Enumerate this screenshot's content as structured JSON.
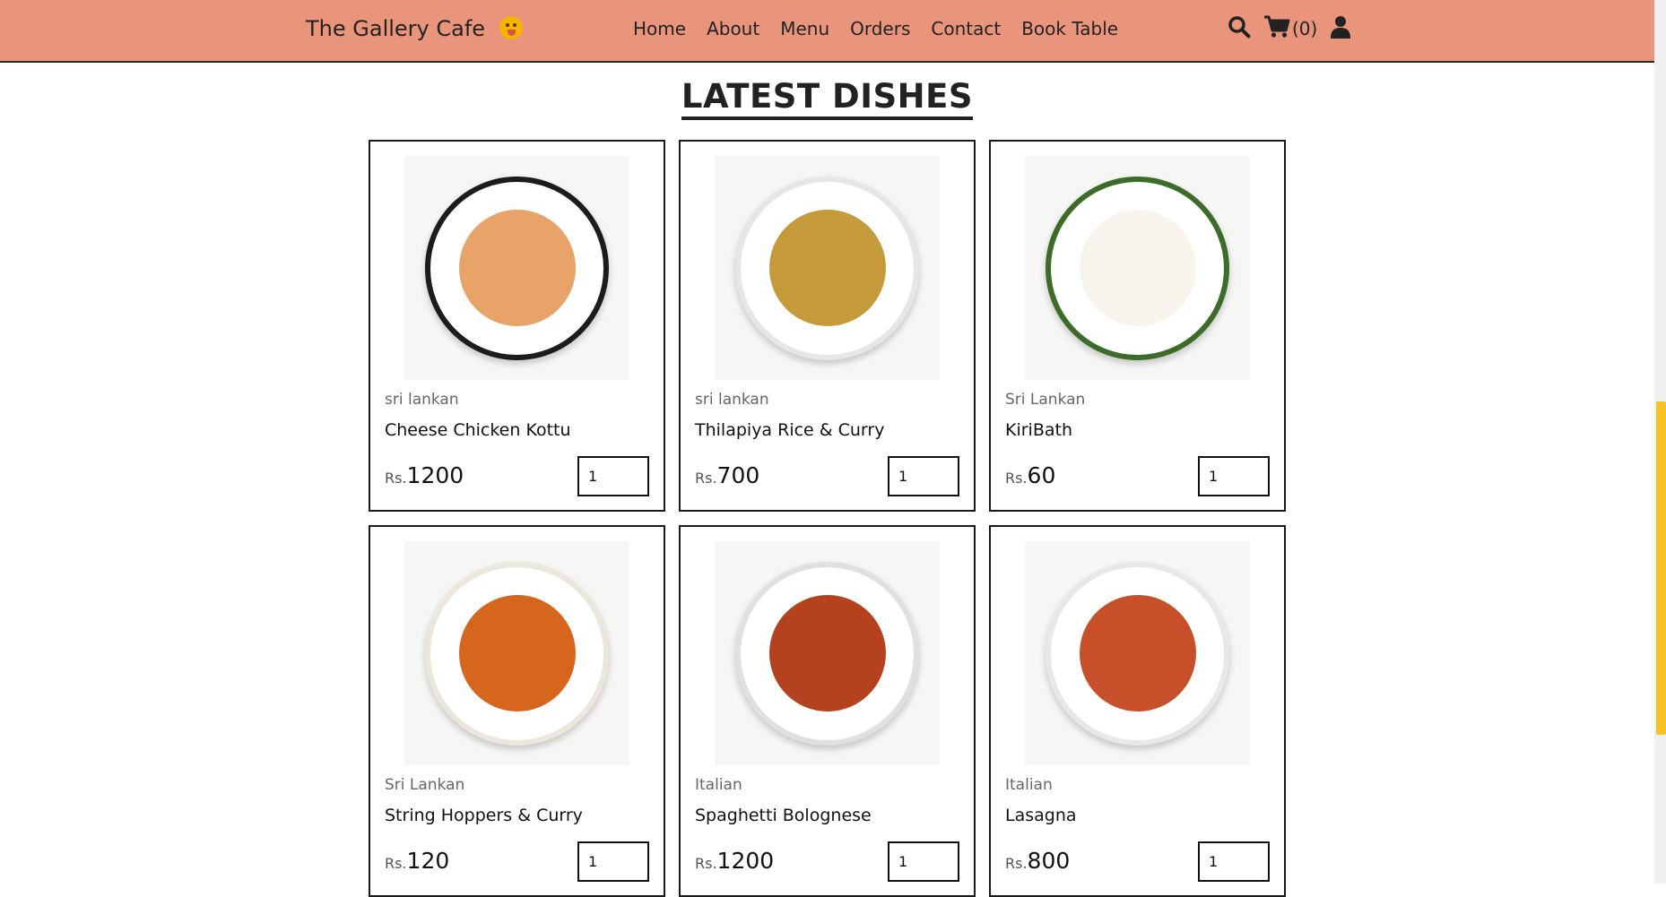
{
  "navbar": {
    "brand": "The Gallery Cafe",
    "links": [
      "Home",
      "About",
      "Menu",
      "Orders",
      "Contact",
      "Book Table"
    ],
    "cart_count": "(0)",
    "colors": {
      "background": "#e9957b"
    }
  },
  "section": {
    "title": "LATEST DISHES"
  },
  "dishes": [
    {
      "origin": "sri lankan",
      "name": "Cheese Chicken Kottu",
      "currency": "Rs.",
      "price": "1200",
      "qty": "1",
      "food_color": "#e8a468",
      "rim_color": "#1c1c1c"
    },
    {
      "origin": "sri lankan",
      "name": "Thilapiya Rice & Curry",
      "currency": "Rs.",
      "price": "700",
      "qty": "1",
      "food_color": "#c49a3a",
      "rim_color": "#e6e6e6"
    },
    {
      "origin": "Sri Lankan",
      "name": "KiriBath",
      "currency": "Rs.",
      "price": "60",
      "qty": "1",
      "food_color": "#f7f5ee",
      "rim_color": "#3d6b2a"
    },
    {
      "origin": "Sri Lankan",
      "name": "String Hoppers & Curry",
      "currency": "Rs.",
      "price": "120",
      "qty": "1",
      "food_color": "#d6661e",
      "rim_color": "#ece7dc"
    },
    {
      "origin": "Italian",
      "name": "Spaghetti Bolognese",
      "currency": "Rs.",
      "price": "1200",
      "qty": "1",
      "food_color": "#b5421e",
      "rim_color": "#e0e0e0"
    },
    {
      "origin": "Italian",
      "name": "Lasagna",
      "currency": "Rs.",
      "price": "800",
      "qty": "1",
      "food_color": "#c7502a",
      "rim_color": "#e8e8e8"
    }
  ],
  "icons": [
    "search-icon",
    "cart-icon",
    "user-icon",
    "emoji-icon"
  ]
}
